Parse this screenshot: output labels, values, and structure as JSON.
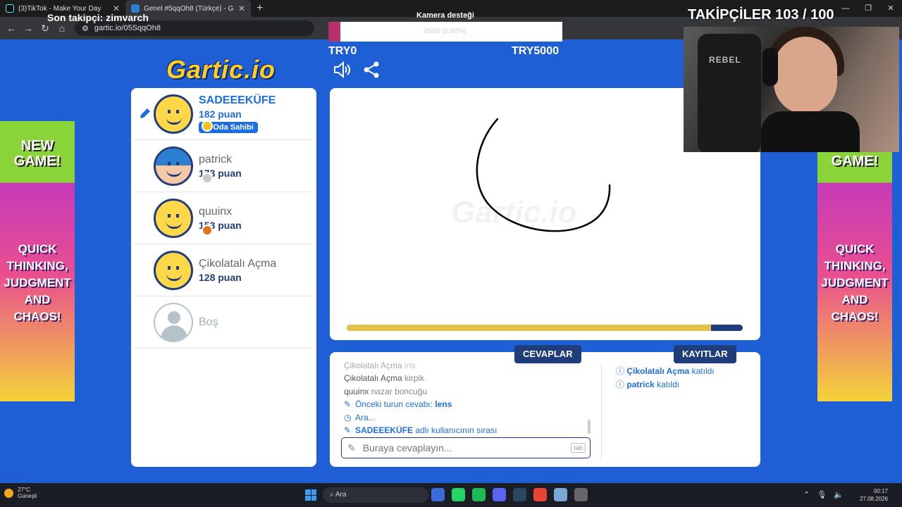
{
  "browser": {
    "tabs": [
      {
        "title": "(3)TikTok - Make Your Day",
        "active": false
      },
      {
        "title": "Genel #5qqOh8 (Türkçe) - Gartic.io",
        "active": true
      }
    ],
    "url": "gartic.io/05SqqOh8"
  },
  "overlay": {
    "camera_label": "Kamera desteği",
    "camera_progress_text": "250$ (5.00%)",
    "camera_progress": 0.05,
    "goal_left": "TRY0",
    "goal_right": "TRY5000",
    "followers": "TAKİPÇİLER 103 / 100",
    "chair_brand": "REBEL",
    "last_follower": "Son takipçi: zimvarch"
  },
  "game": {
    "logo": "Gartic.io",
    "watermark": "Gartic.io",
    "timer_progress": 0.92,
    "players": [
      {
        "name": "SADEEEKÜFE",
        "points": "182 puan",
        "badge": "Oda Sahibi",
        "is_drawer": true,
        "status_color": "#f5c21b"
      },
      {
        "name": "patrick",
        "points": "173 puan",
        "status_color": "#c9c9c9"
      },
      {
        "name": "quuinx",
        "points": "153 puan",
        "status_color": "#e0761b"
      },
      {
        "name": "Çikolatalı Açma",
        "points": "128 puan"
      }
    ],
    "empty_slot": "Boş",
    "answers_tab": "CEVAPLAR",
    "logs_tab": "KAYITLAR",
    "answers": [
      {
        "user": "Çikolatalı Açma",
        "text": "iris"
      },
      {
        "user": "Çikolatalı Açma",
        "text": "kirpik"
      },
      {
        "user": "quuinx",
        "text": "nazar boncuğu"
      }
    ],
    "system_messages": {
      "previous_answer_label": "Önceki turun cevabı:",
      "previous_answer": "lens",
      "searching": "Ara...",
      "turn_user": "SADEEEKÜFE",
      "turn_text": "adlı kullanıcının sırası"
    },
    "answer_placeholder": "Buraya cevaplayın...",
    "tab_hint": "tab",
    "logs": [
      {
        "user": "Çikolatalı Açma",
        "text": "katıldı"
      },
      {
        "user": "patrick",
        "text": "katıldı"
      }
    ]
  },
  "ads": {
    "headline": "NEW GAME!",
    "slogan": "QUICK THINKING, JUDGMENT AND CHAOS!"
  },
  "taskbar": {
    "temperature": "27°C",
    "weather": "Güneşli",
    "search": "Ara",
    "time": "00:17",
    "date": "27.08.2026"
  }
}
